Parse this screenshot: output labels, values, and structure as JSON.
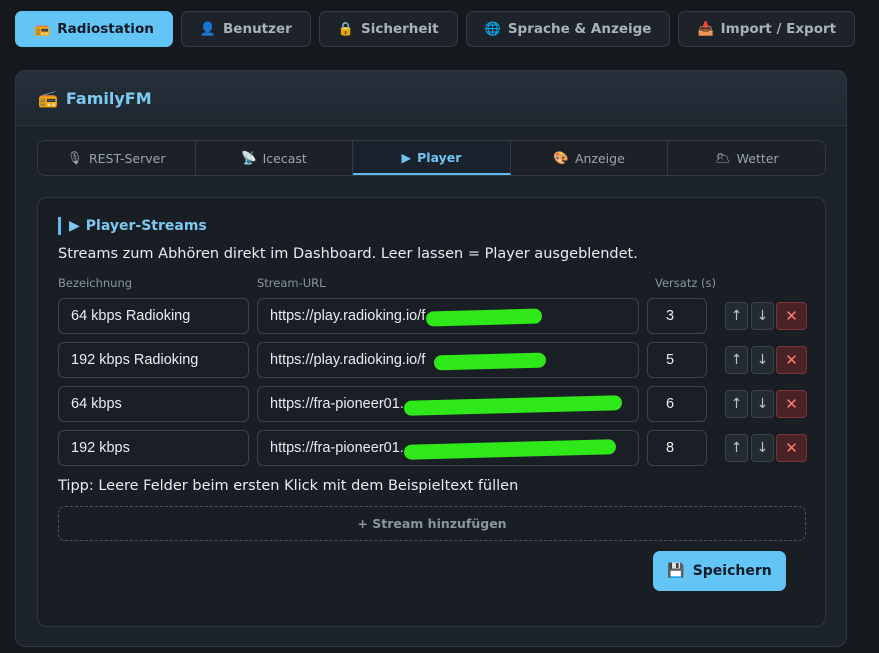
{
  "top_tabs": [
    {
      "icon": "📻",
      "label": "Radiostation",
      "active": true
    },
    {
      "icon": "👤",
      "label": "Benutzer"
    },
    {
      "icon": "🔒",
      "label": "Sicherheit"
    },
    {
      "icon": "🌐",
      "label": "Sprache & Anzeige"
    },
    {
      "icon": "📥",
      "label": "Import / Export"
    }
  ],
  "station": {
    "icon": "📻",
    "title": "FamilyFM"
  },
  "sub_tabs": [
    {
      "icon": "🎙",
      "label": "REST-Server"
    },
    {
      "icon": "📡",
      "label": "Icecast"
    },
    {
      "icon": "▶",
      "label": "Player",
      "active": true
    },
    {
      "icon": "🎨",
      "label": "Anzeige"
    },
    {
      "icon": "🌥",
      "label": "Wetter"
    }
  ],
  "player": {
    "section_icon": "▶",
    "section_title": "Player-Streams",
    "description": "Streams zum Abhören direkt im Dashboard. Leer lassen = Player ausgeblendet.",
    "col_name": "Bezeichnung",
    "col_url": "Stream-URL",
    "col_offset": "Versatz (s)",
    "streams": [
      {
        "name": "64 kbps Radioking",
        "url": "https://play.radioking.io/f",
        "offset": "3"
      },
      {
        "name": "192 kbps Radioking",
        "url": "https://play.radioking.io/f",
        "offset": "5"
      },
      {
        "name": "64 kbps",
        "url": "https://fra-pioneer01.",
        "offset": "6"
      },
      {
        "name": "192 kbps",
        "url": "https://fra-pioneer01.",
        "offset": "8"
      }
    ],
    "tip": "Tipp: Leere Felder beim ersten Klick mit dem Beispieltext füllen",
    "add_label": "+ Stream hinzufügen",
    "save_icon": "💾",
    "save_label": "Speichern",
    "up_glyph": "↑",
    "down_glyph": "↓",
    "delete_glyph": "✕"
  },
  "colors": {
    "accent": "#63c4f6",
    "redaction": "#2ee81a",
    "danger": "#ff7b72"
  }
}
